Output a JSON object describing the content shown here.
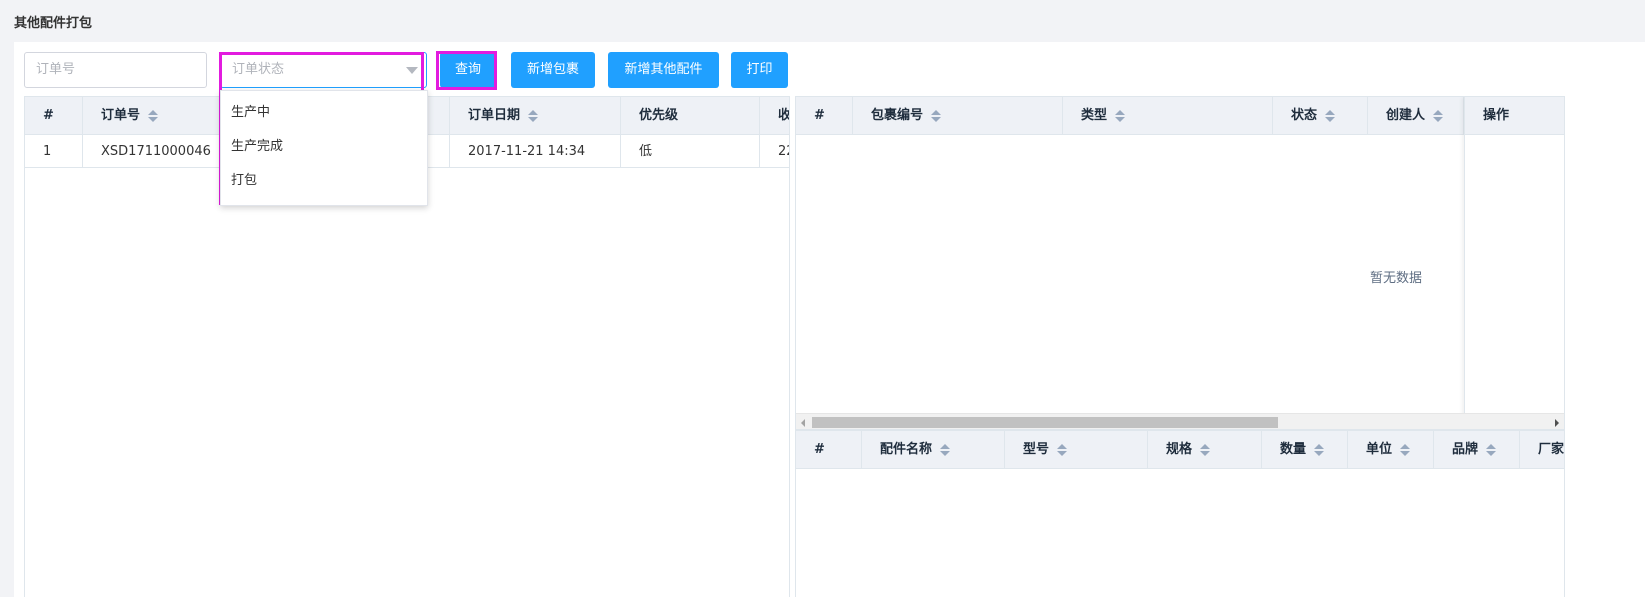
{
  "page": {
    "title": "其他配件打包"
  },
  "toolbar": {
    "order_no_placeholder": "订单号",
    "status_placeholder": "订单状态",
    "query_label": "查询",
    "add_package_label": "新增包裹",
    "add_accessory_label": "新增其他配件",
    "print_label": "打印"
  },
  "status_dropdown": {
    "options": [
      "生产中",
      "生产完成",
      "打包"
    ]
  },
  "orders_table": {
    "columns": [
      "#",
      "订单号",
      "订单日期",
      "优先级",
      "收"
    ],
    "rows": [
      {
        "index": "1",
        "order_no": "XSD1711000046",
        "date": "2017-11-21 14:34",
        "priority": "低",
        "recv": "22"
      }
    ]
  },
  "packages_table": {
    "columns": [
      "#",
      "包裹编号",
      "类型",
      "状态",
      "创建人",
      "操作"
    ],
    "empty_text": "暂无数据"
  },
  "accessories_table": {
    "columns": [
      "#",
      "配件名称",
      "型号",
      "规格",
      "数量",
      "单位",
      "品牌",
      "厂家"
    ]
  },
  "colors": {
    "primary": "#20a0ff",
    "highlight": "#e21bdf",
    "header_bg": "#eef1f6"
  }
}
